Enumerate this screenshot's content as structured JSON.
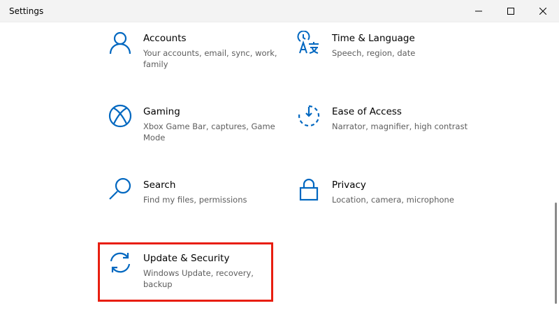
{
  "window": {
    "title": "Settings",
    "accent_color": "#0067c0",
    "highlight_color": "#e81e10"
  },
  "controls": {
    "minimize_icon": "minimize-icon",
    "maximize_icon": "maximize-icon",
    "close_icon": "close-icon"
  },
  "tiles": [
    {
      "name": "Accounts",
      "desc": "Your accounts, email, sync, work, family",
      "icon": "person-icon"
    },
    {
      "name": "Time & Language",
      "desc": "Speech, region, date",
      "icon": "time-language-icon"
    },
    {
      "name": "Gaming",
      "desc": "Xbox Game Bar, captures, Game Mode",
      "icon": "xbox-icon"
    },
    {
      "name": "Ease of Access",
      "desc": "Narrator, magnifier, high contrast",
      "icon": "ease-of-access-icon"
    },
    {
      "name": "Search",
      "desc": "Find my files, permissions",
      "icon": "search-icon"
    },
    {
      "name": "Privacy",
      "desc": "Location, camera, microphone",
      "icon": "lock-icon"
    },
    {
      "name": "Update & Security",
      "desc": "Windows Update, recovery, backup",
      "icon": "sync-icon"
    }
  ]
}
